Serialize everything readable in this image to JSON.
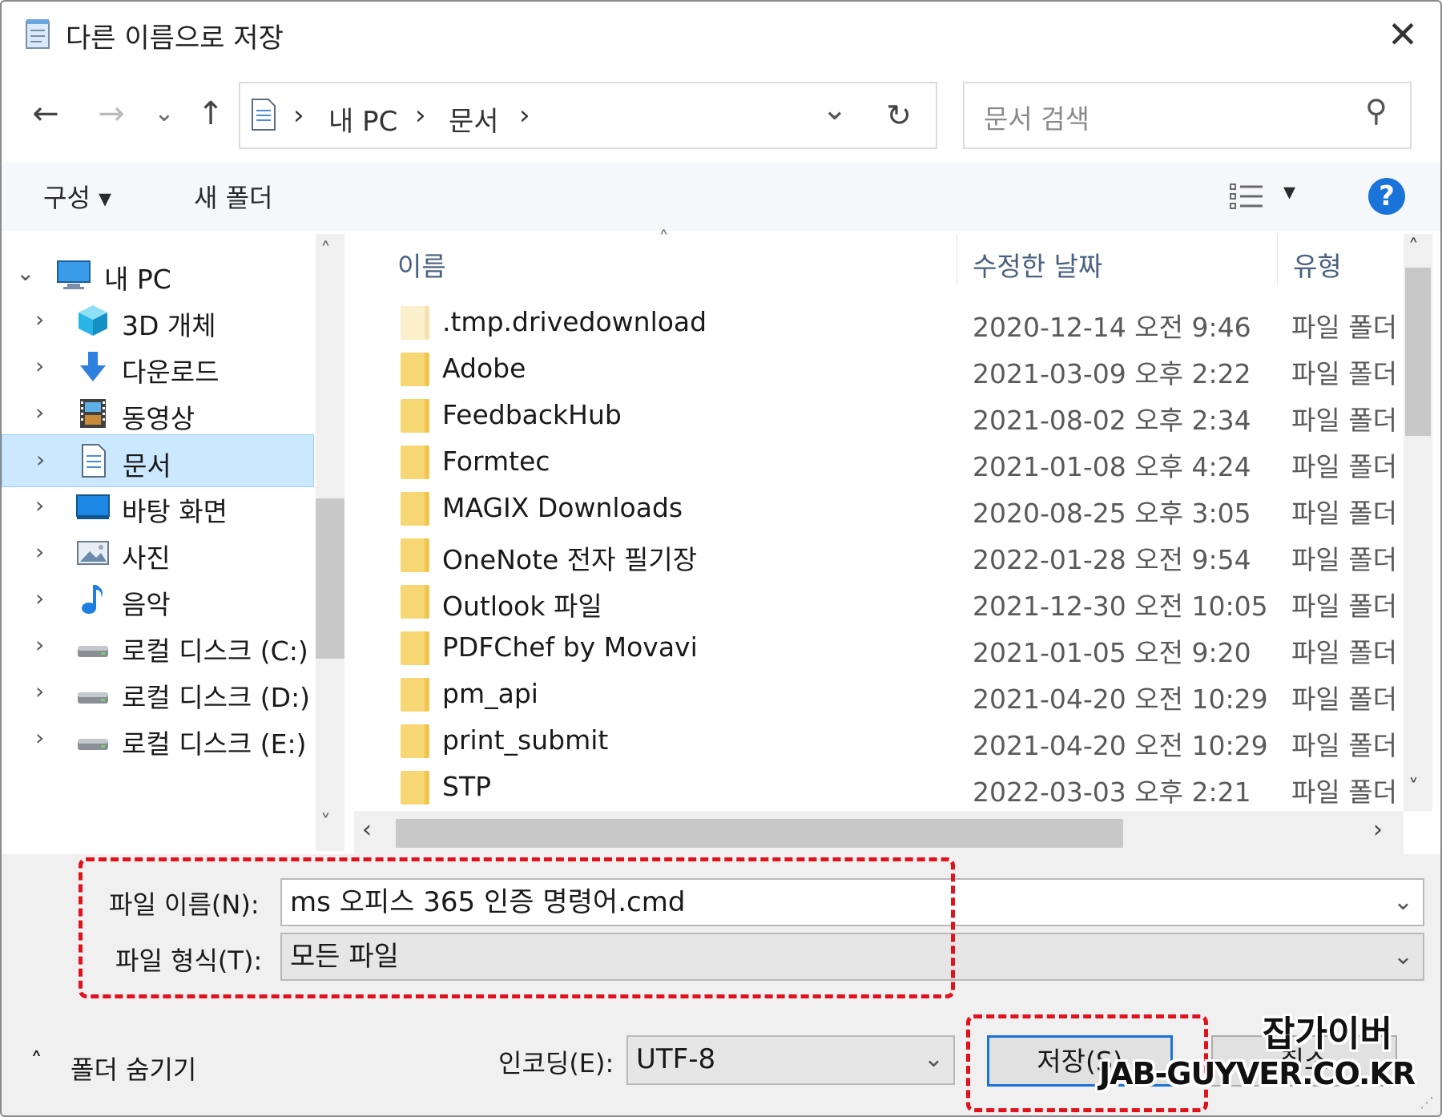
{
  "window": {
    "title": "다른 이름으로 저장",
    "close_glyph": "✕"
  },
  "nav": {
    "back": "←",
    "forward": "→",
    "recent": "⌄",
    "up": "↑",
    "refresh": "↻"
  },
  "address": {
    "crumbs": [
      "내 PC",
      "문서"
    ],
    "sep": "›",
    "dropdown": "⌄"
  },
  "search": {
    "placeholder": "문서 검색",
    "icon_glyph": "⚲"
  },
  "toolbar": {
    "organize": "구성 ▾",
    "new_folder": "새 폴더",
    "view_glyph": "▾",
    "help": "?"
  },
  "tree": {
    "root": "내 PC",
    "items": [
      {
        "label": "3D 개체",
        "icon": "cube-icon"
      },
      {
        "label": "다운로드",
        "icon": "download-icon"
      },
      {
        "label": "동영상",
        "icon": "video-icon"
      },
      {
        "label": "문서",
        "icon": "document-icon",
        "selected": true
      },
      {
        "label": "바탕 화면",
        "icon": "desktop-icon"
      },
      {
        "label": "사진",
        "icon": "picture-icon"
      },
      {
        "label": "음악",
        "icon": "music-icon"
      },
      {
        "label": "로컬 디스크 (C:)",
        "icon": "drive-icon"
      },
      {
        "label": "로컬 디스크 (D:)",
        "icon": "drive-icon"
      },
      {
        "label": "로컬 디스크 (E:)",
        "icon": "drive-icon"
      }
    ]
  },
  "columns": {
    "name": "이름",
    "date": "수정한 날짜",
    "type": "유형"
  },
  "files": [
    {
      "name": ".tmp.drivedownload",
      "date": "2020-12-14 오전 9:46",
      "type": "파일 폴더",
      "light": true
    },
    {
      "name": "Adobe",
      "date": "2021-03-09 오후 2:22",
      "type": "파일 폴더"
    },
    {
      "name": "FeedbackHub",
      "date": "2021-08-02 오후 2:34",
      "type": "파일 폴더"
    },
    {
      "name": "Formtec",
      "date": "2021-01-08 오후 4:24",
      "type": "파일 폴더"
    },
    {
      "name": "MAGIX Downloads",
      "date": "2020-08-25 오후 3:05",
      "type": "파일 폴더"
    },
    {
      "name": "OneNote 전자 필기장",
      "date": "2022-01-28 오전 9:54",
      "type": "파일 폴더"
    },
    {
      "name": "Outlook 파일",
      "date": "2021-12-30 오전 10:05",
      "type": "파일 폴더"
    },
    {
      "name": "PDFChef by Movavi",
      "date": "2021-01-05 오전 9:20",
      "type": "파일 폴더"
    },
    {
      "name": "pm_api",
      "date": "2021-04-20 오전 10:29",
      "type": "파일 폴더"
    },
    {
      "name": "print_submit",
      "date": "2021-04-20 오전 10:29",
      "type": "파일 폴더"
    },
    {
      "name": "STP",
      "date": "2022-03-03 오후 2:21",
      "type": "파일 폴더"
    }
  ],
  "form": {
    "filename_label": "파일 이름(N):",
    "filename_value": "ms 오피스 365 인증 명령어.cmd",
    "filetype_label": "파일 형식(T):",
    "filetype_value": "모든 파일",
    "encoding_label": "인코딩(E):",
    "encoding_value": "UTF-8"
  },
  "footer": {
    "hide_folders": "폴더 숨기기",
    "save": "저장(S)",
    "cancel": "취소"
  },
  "watermark": {
    "line1": "잡가이버",
    "line2": "JAB-GUYVER.CO.KR"
  },
  "colors": {
    "accent": "#1a73d9",
    "highlight": "#e0121d",
    "folder": "#f7d774",
    "selection": "#cce8ff"
  }
}
